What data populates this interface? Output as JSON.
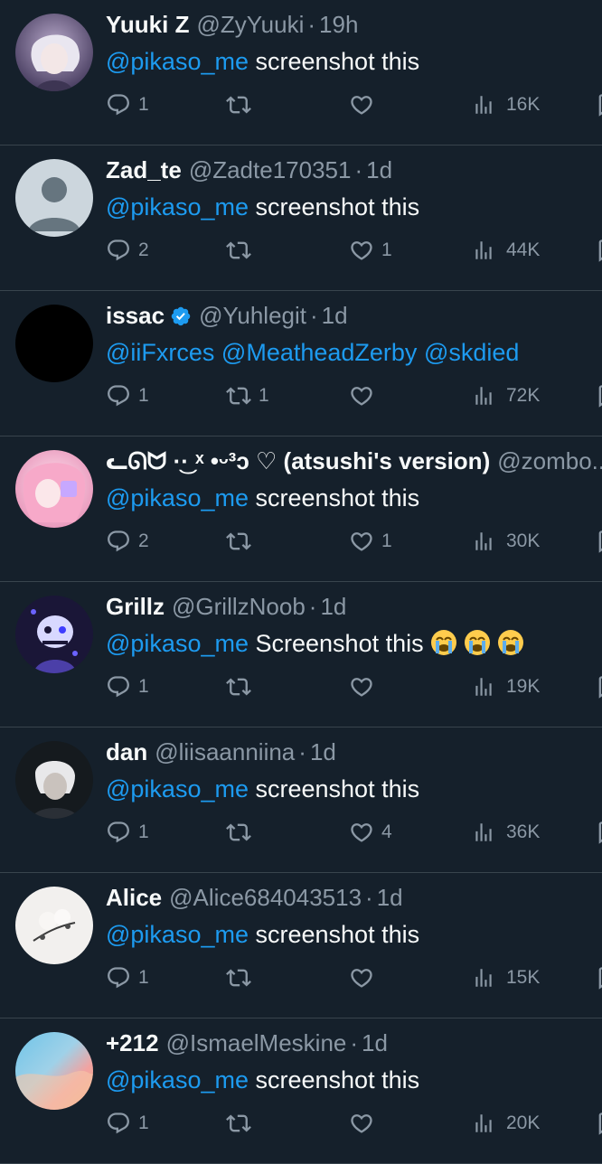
{
  "tweets": [
    {
      "name": "Yuuki Z",
      "handle": "@ZyYuuki",
      "time": "19h",
      "verified": false,
      "mentions": [
        "@pikaso_me"
      ],
      "text": "screenshot this",
      "emojis": [],
      "replies": "1",
      "retweets": "",
      "likes": "",
      "views": "16K",
      "avatar": "anime-white-hair"
    },
    {
      "name": "Zad_te",
      "handle": "@Zadte170351",
      "time": "1d",
      "verified": false,
      "mentions": [
        "@pikaso_me"
      ],
      "text": "screenshot this",
      "emojis": [],
      "replies": "2",
      "retweets": "",
      "likes": "1",
      "views": "44K",
      "avatar": "default-profile"
    },
    {
      "name": "issac",
      "handle": "@Yuhlegit",
      "time": "1d",
      "verified": true,
      "mentions": [
        "@iiFxrces",
        "@MeatheadZerby",
        "@skdied"
      ],
      "text": "",
      "emojis": [],
      "replies": "1",
      "retweets": "1",
      "likes": "",
      "views": "72K",
      "avatar": "black"
    },
    {
      "name": "ᓚᘏᗢ ·͜· ˣ •ᵕ³ᴐ ♡ (atsushi's version)",
      "handle": "@zombo...",
      "time": "",
      "verified": false,
      "mentions": [
        "@pikaso_me"
      ],
      "text": "screenshot this",
      "emojis": [],
      "replies": "2",
      "retweets": "",
      "likes": "1",
      "views": "30K",
      "avatar": "pink-anime"
    },
    {
      "name": "Grillz",
      "handle": "@GrillzNoob",
      "time": "1d",
      "verified": false,
      "mentions": [
        "@pikaso_me"
      ],
      "text": "Screenshot this",
      "emojis": [
        "loudly-crying-face",
        "loudly-crying-face",
        "loudly-crying-face"
      ],
      "replies": "1",
      "retweets": "",
      "likes": "",
      "views": "19K",
      "avatar": "purple-skeleton"
    },
    {
      "name": "dan",
      "handle": "@liisaanniina",
      "time": "1d",
      "verified": false,
      "mentions": [
        "@pikaso_me"
      ],
      "text": "screenshot this",
      "emojis": [],
      "replies": "1",
      "retweets": "",
      "likes": "4",
      "views": "36K",
      "avatar": "anime-dark"
    },
    {
      "name": "Alice",
      "handle": "@Alice684043513",
      "time": "1d",
      "verified": false,
      "mentions": [
        "@pikaso_me"
      ],
      "text": "screenshot this",
      "emojis": [],
      "replies": "1",
      "retweets": "",
      "likes": "",
      "views": "15K",
      "avatar": "white-flower"
    },
    {
      "name": "+212",
      "handle": "@IsmaelMeskine",
      "time": "1d",
      "verified": false,
      "mentions": [
        "@pikaso_me"
      ],
      "text": "screenshot this",
      "emojis": [],
      "replies": "1",
      "retweets": "",
      "likes": "",
      "views": "20K",
      "avatar": "sunset-sky"
    }
  ],
  "colors": {
    "background": "#15202b",
    "text": "#f7f9f9",
    "muted": "#8b98a5",
    "link": "#1d9bf0",
    "divider": "#38444d"
  }
}
